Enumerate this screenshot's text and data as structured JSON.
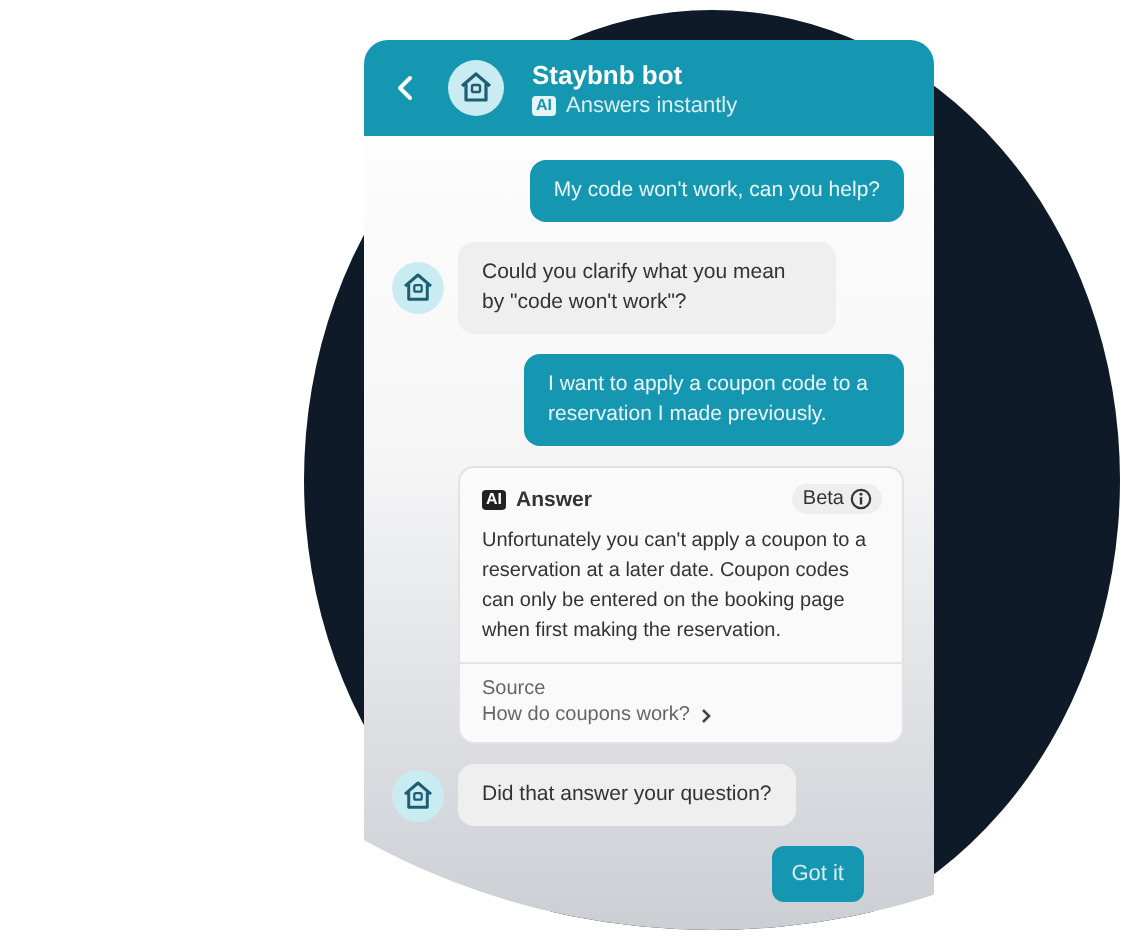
{
  "header": {
    "title": "Staybnb bot",
    "badge": "AI",
    "subtitle": "Answers instantly"
  },
  "messages": [
    {
      "kind": "user",
      "text": "My code won't work, can you help?"
    },
    {
      "kind": "bot",
      "text": "Could you clarify what you mean by \"code won't work\"?"
    },
    {
      "kind": "user",
      "text": "I want to apply a coupon code to a reservation I made previously."
    },
    {
      "kind": "answer",
      "badge": "AI",
      "title": "Answer",
      "tag": "Beta",
      "text": "Unfortunately you can't apply a coupon to a reservation at a later date. Coupon codes can only be entered on the booking page when first making the reservation.",
      "source_label": "Source",
      "source_link": "How do coupons work?"
    },
    {
      "kind": "bot",
      "text": "Did that answer your question?"
    }
  ],
  "quick_replies": [
    "Got it"
  ]
}
